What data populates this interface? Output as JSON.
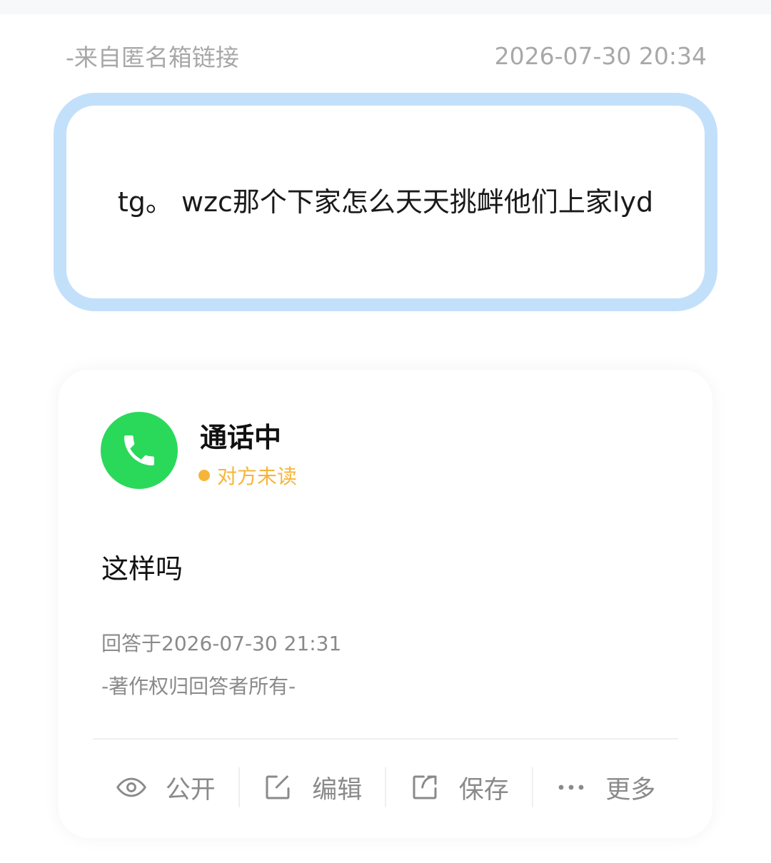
{
  "question": {
    "source": "-来自匿名箱链接",
    "timestamp": "2026-07-30 20:34",
    "text": "tg。 wzc那个下家怎么天天挑衅他们上家lyd"
  },
  "answer": {
    "avatar_icon": "phone-icon",
    "avatar_color": "#2ad95a",
    "status_title": "通话中",
    "read_status": "对方未读",
    "read_status_color": "#f6b53a",
    "text": "这样吗",
    "answered_at": "回答于2026-07-30 21:31",
    "copyright": "-著作权归回答者所有-",
    "actions": [
      {
        "label": "公开",
        "icon": "eye-icon"
      },
      {
        "label": "编辑",
        "icon": "edit-icon"
      },
      {
        "label": "保存",
        "icon": "share-icon"
      },
      {
        "label": "更多",
        "icon": "more-icon"
      }
    ]
  },
  "colors": {
    "question_border": "#c3e0fb",
    "muted_text": "#a8a8a8"
  }
}
